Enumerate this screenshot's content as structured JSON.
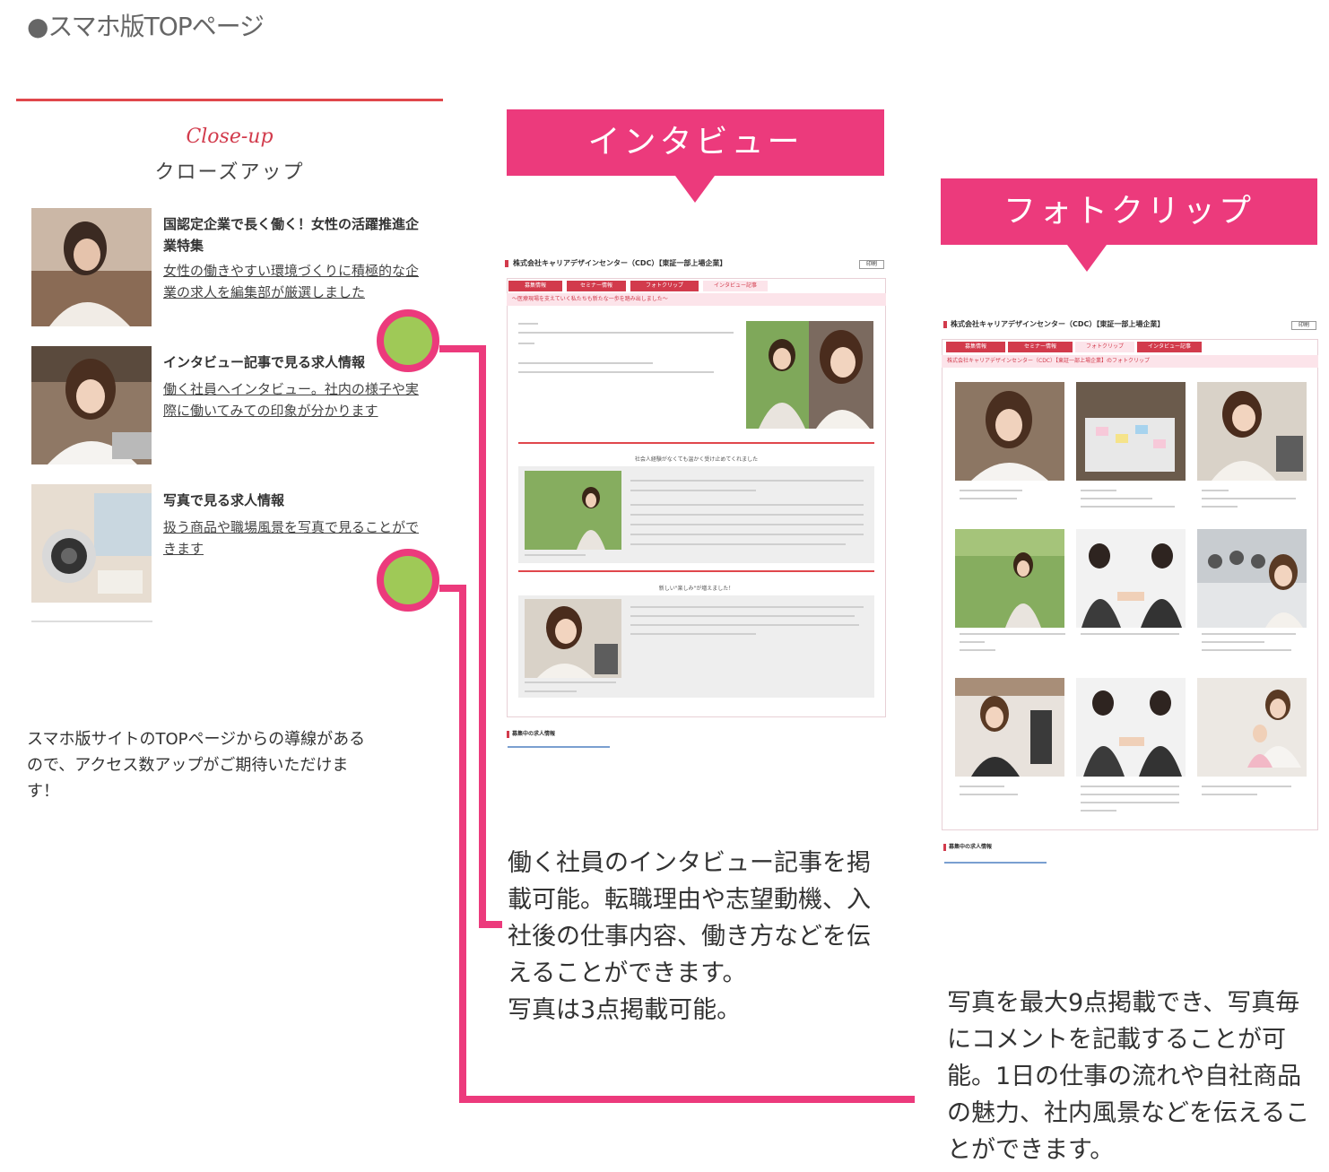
{
  "page_heading": "●スマホ版TOPページ",
  "closeup": {
    "script_title": "Close-up",
    "title": "クローズアップ",
    "items": [
      {
        "title": "国認定企業で長く働く！女性の活躍推進企業特集",
        "desc": "女性の働きやすい環境づくりに積極的な企業の求人を編集部が厳選しました"
      },
      {
        "title": "インタビュー記事で見る求人情報",
        "desc": "働く社員へインタビュー。社内の様子や実際に働いてみての印象が分かります"
      },
      {
        "title": "写真で見る求人情報",
        "desc": "扱う商品や職場風景を写真で見ることができます"
      }
    ]
  },
  "left_note": "スマホ版サイトのTOPページからの導線があるので、アクセス数アップがご期待いただけます！",
  "interview": {
    "banner": "インタビュー",
    "preview_header": "株式会社キャリアデザインセンター（CDC）【東証一部上場企業】",
    "preview_button": "印刷",
    "tabs": [
      "募集情報",
      "セミナー情報",
      "フォトクリップ",
      "インタビュー記事"
    ],
    "band": "～医療現場を支えていく私たちも新たな一歩を踏み出しました～",
    "section1": "社会人経験がなくても温かく受け止めてくれました",
    "section2": "新しい\"楽しみ\"が増えました！",
    "footer_link": "募集中の求人情報",
    "description": "働く社員のインタビュー記事を掲載可能。転職理由や志望動機、入社後の仕事内容、働き方などを伝えることができます。\n写真は3点掲載可能。"
  },
  "photoclip": {
    "banner": "フォトクリップ",
    "preview_header": "株式会社キャリアデザインセンター（CDC）【東証一部上場企業】",
    "preview_button": "印刷",
    "tabs": [
      "募集情報",
      "セミナー情報",
      "フォトクリップ",
      "インタビュー記事"
    ],
    "band": "株式会社キャリアデザインセンター（CDC）【東証一部上場企業】のフォトクリップ",
    "footer_link": "募集中の求人情報",
    "description": "写真を最大9点掲載でき、写真毎にコメントを記載することが可能。1日の仕事の流れや自社商品の魅力、社内風景などを伝えることができます。"
  },
  "colors": {
    "accent": "#ec3a7c",
    "dot": "#9fc957",
    "rule": "#e0474c"
  }
}
